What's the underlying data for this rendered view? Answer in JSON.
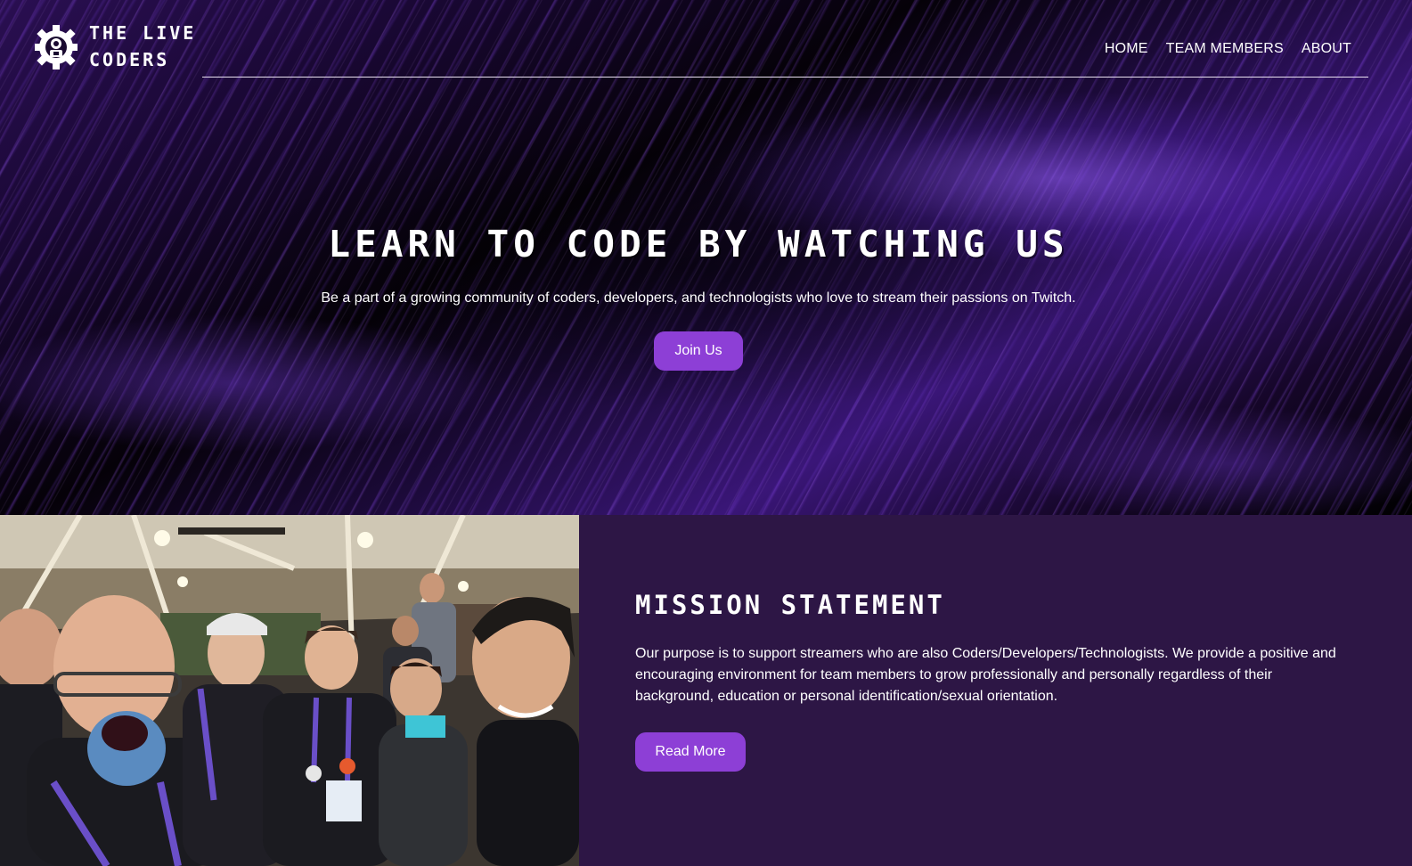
{
  "header": {
    "logo_line1": "THE LIVE",
    "logo_line2": "CODERS",
    "logo_icon": "gear-robot-icon",
    "nav": [
      {
        "label": "HOME"
      },
      {
        "label": "TEAM MEMBERS"
      },
      {
        "label": "ABOUT"
      }
    ]
  },
  "hero": {
    "title": "LEARN TO CODE BY WATCHING US",
    "subtitle": "Be a part of a growing community of coders, developers, and technologists who love to stream their passions on Twitch.",
    "button_label": "Join Us"
  },
  "mission": {
    "title": "MISSION STATEMENT",
    "text": "Our purpose is to support streamers who are also Coders/Developers/Technologists. We provide a positive and encouraging environment for team members to grow professionally and personally regardless of their background, education or personal identification/sexual orientation.",
    "button_label": "Read More"
  },
  "colors": {
    "accent": "#8d3fd6",
    "mission_bg": "#2d1645",
    "hero_bg": "#14062b"
  }
}
